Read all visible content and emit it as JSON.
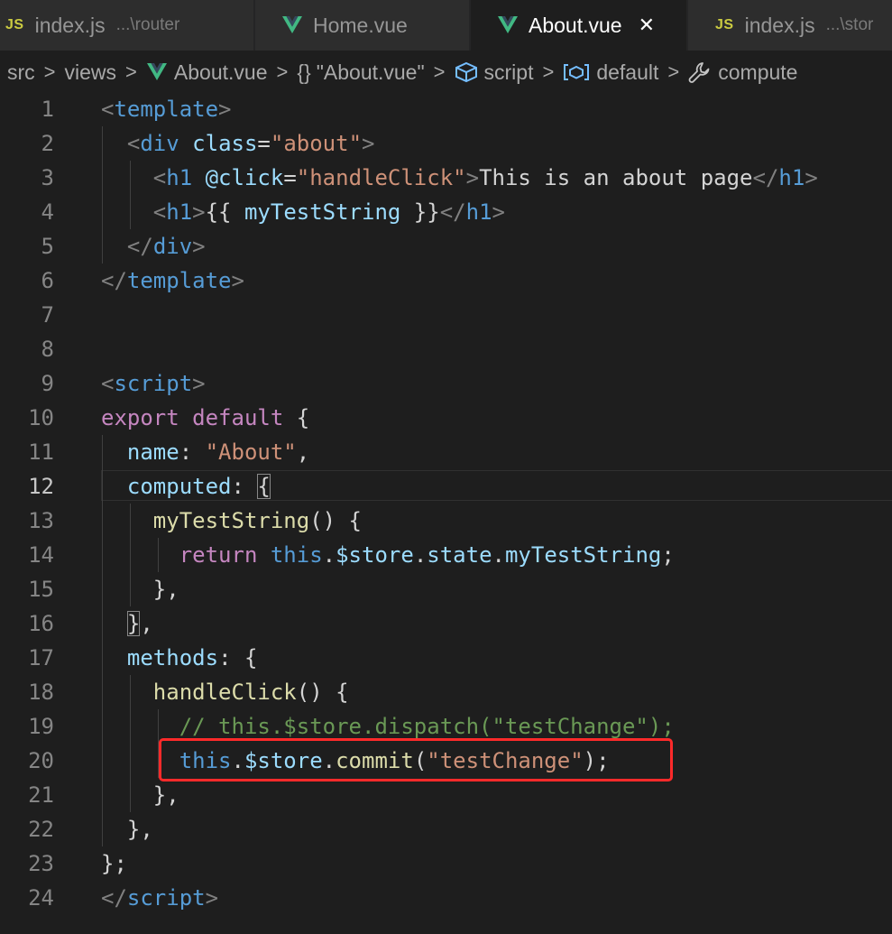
{
  "tabs": [
    {
      "icon": "js-icon",
      "icon_text": "JS",
      "label": "index.js",
      "hint": "...\\router",
      "active": false
    },
    {
      "icon": "vue-icon",
      "label": "Home.vue",
      "active": false
    },
    {
      "icon": "vue-icon",
      "label": "About.vue",
      "active": true,
      "close": "✕"
    },
    {
      "icon": "js-icon",
      "icon_text": "JS",
      "label": "index.js",
      "hint": "...\\stor",
      "active": false
    }
  ],
  "breadcrumb": {
    "items": [
      "src",
      "views",
      "About.vue",
      "\"About.vue\"",
      "script",
      "default",
      "compute"
    ],
    "braces": "{}",
    "separator": ">"
  },
  "editor": {
    "active_line": 12,
    "lines": [
      {
        "n": "1"
      },
      {
        "n": "2"
      },
      {
        "n": "3"
      },
      {
        "n": "4"
      },
      {
        "n": "5"
      },
      {
        "n": "6"
      },
      {
        "n": "7"
      },
      {
        "n": "8"
      },
      {
        "n": "9"
      },
      {
        "n": "10"
      },
      {
        "n": "11"
      },
      {
        "n": "12"
      },
      {
        "n": "13"
      },
      {
        "n": "14"
      },
      {
        "n": "15"
      },
      {
        "n": "16"
      },
      {
        "n": "17"
      },
      {
        "n": "18"
      },
      {
        "n": "19"
      },
      {
        "n": "20"
      },
      {
        "n": "21"
      },
      {
        "n": "22"
      },
      {
        "n": "23"
      },
      {
        "n": "24"
      }
    ],
    "code": {
      "l1": {
        "lt": "<",
        "tag": "template",
        "gt": ">"
      },
      "l2": {
        "lt": "<",
        "tag": "div",
        "attr": "class",
        "eq": "=",
        "val": "\"about\"",
        "gt": ">"
      },
      "l3": {
        "lt": "<",
        "tag": "h1",
        "attr": "@click",
        "eq": "=",
        "val": "\"handleClick\"",
        "gt": ">",
        "text": "This is an about page",
        "close_lt": "</",
        "close_tag": "h1",
        "close_gt": ">"
      },
      "l4": {
        "lt": "<",
        "tag": "h1",
        "gt": ">",
        "open_mustache": "{{ ",
        "expr": "myTestString",
        "close_mustache": " }}",
        "close_lt": "</",
        "close_tag": "h1",
        "close_gt": ">"
      },
      "l5": {
        "lt": "</",
        "tag": "div",
        "gt": ">"
      },
      "l6": {
        "lt": "</",
        "tag": "template",
        "gt": ">"
      },
      "l9": {
        "lt": "<",
        "tag": "script",
        "gt": ">"
      },
      "l10": {
        "kw1": "export",
        "kw2": "default",
        "brace": "{"
      },
      "l11": {
        "key": "name",
        "colon": ": ",
        "str": "\"About\"",
        "comma": ","
      },
      "l12": {
        "key": "computed",
        "colon": ": ",
        "brace": "{"
      },
      "l13": {
        "fn": "myTestString",
        "rest": "() {"
      },
      "l14": {
        "kw": "return",
        "this": "this",
        "rest1": ".",
        "prop1": "$store",
        "dot2": ".",
        "prop2": "state",
        "dot3": ".",
        "prop3": "myTestString",
        "semi": ";"
      },
      "l15": {
        "text": "},"
      },
      "l16": {
        "brace": "}",
        "comma": ","
      },
      "l17": {
        "key": "methods",
        "colon": ": ",
        "brace": "{"
      },
      "l18": {
        "fn": "handleClick",
        "rest": "() {"
      },
      "l19": {
        "comment": "// this.$store.dispatch(\"testChange\");"
      },
      "l20": {
        "this": "this",
        "dot1": ".",
        "prop1": "$store",
        "dot2": ".",
        "fn": "commit",
        "p1": "(",
        "str": "\"testChange\"",
        "p2": ");"
      },
      "l21": {
        "text": "},"
      },
      "l22": {
        "text": "},"
      },
      "l23": {
        "text": "};"
      },
      "l24": {
        "lt": "</",
        "tag": "script",
        "gt": ">"
      }
    }
  },
  "colors": {
    "background": "#1e1e1e",
    "tag_bracket": "#808080",
    "tag_name": "#569cd6",
    "attribute": "#9cdcfe",
    "string": "#ce9178",
    "keyword": "#c586c0",
    "function": "#dcdcaa",
    "comment": "#6a9955",
    "highlight_box": "#ff2a2a",
    "js_icon": "#cbcb41",
    "vue_icon": "#41b883"
  }
}
